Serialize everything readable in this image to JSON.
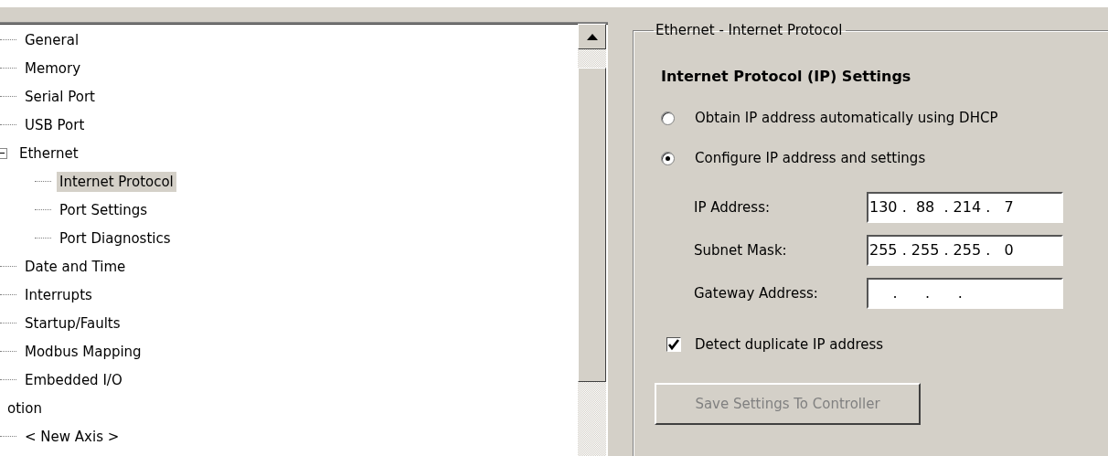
{
  "tree": {
    "items": [
      {
        "children": [
          {
            "label": "General"
          },
          {
            "label": "Memory"
          },
          {
            "label": "Serial Port"
          },
          {
            "label": "USB Port"
          },
          {
            "label": "Ethernet",
            "expanded": true,
            "children": [
              {
                "label": "Internet Protocol",
                "selected": true
              },
              {
                "label": "Port Settings",
                "selected": false
              },
              {
                "label": "Port Diagnostics",
                "selected": false
              }
            ]
          },
          {
            "label": "Date and Time"
          },
          {
            "label": "Interrupts"
          },
          {
            "label": "Startup/Faults"
          },
          {
            "label": "Modbus Mapping"
          },
          {
            "label": "Embedded I/O"
          }
        ]
      },
      {
        "label": "otion",
        "children": [
          {
            "label": "< New Axis >"
          }
        ]
      }
    ]
  },
  "group": {
    "title": "Ethernet - Internet Protocol",
    "heading": "Internet Protocol (IP) Settings",
    "options": [
      {
        "label": "Obtain IP address automatically using DHCP",
        "selected": false
      },
      {
        "label": "Configure IP address and settings",
        "selected": true
      }
    ],
    "fields": [
      {
        "label": "IP Address:",
        "value": "130 .  88  . 214 .   7"
      },
      {
        "label": "Subnet Mask:",
        "value": "255 . 255 . 255 .   0"
      },
      {
        "label": "Gateway Address:",
        "value": "     .      .      ."
      }
    ],
    "duplicate_check": {
      "label": "Detect duplicate IP address",
      "checked": true
    },
    "save_button": {
      "label": "Save Settings To Controller",
      "disabled": true
    }
  }
}
